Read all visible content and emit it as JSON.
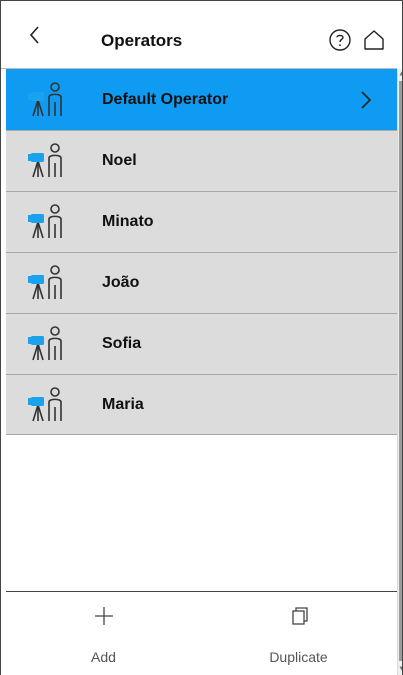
{
  "header": {
    "title": "Operators",
    "back_icon": "chevron-left-icon",
    "help_icon": "question-circle-icon",
    "home_icon": "home-icon"
  },
  "operators": [
    {
      "name": "Default Operator",
      "selected": true
    },
    {
      "name": "Noel",
      "selected": false
    },
    {
      "name": "Minato",
      "selected": false
    },
    {
      "name": "João",
      "selected": false
    },
    {
      "name": "Sofia",
      "selected": false
    },
    {
      "name": "Maria",
      "selected": false
    }
  ],
  "footer": {
    "add_label": "Add",
    "duplicate_label": "Duplicate",
    "add_icon": "plus-icon",
    "duplicate_icon": "copy-icon"
  },
  "colors": {
    "selected": "#0f9bf2",
    "row": "#dcdcdc",
    "instrument": "#1aa3ec"
  }
}
